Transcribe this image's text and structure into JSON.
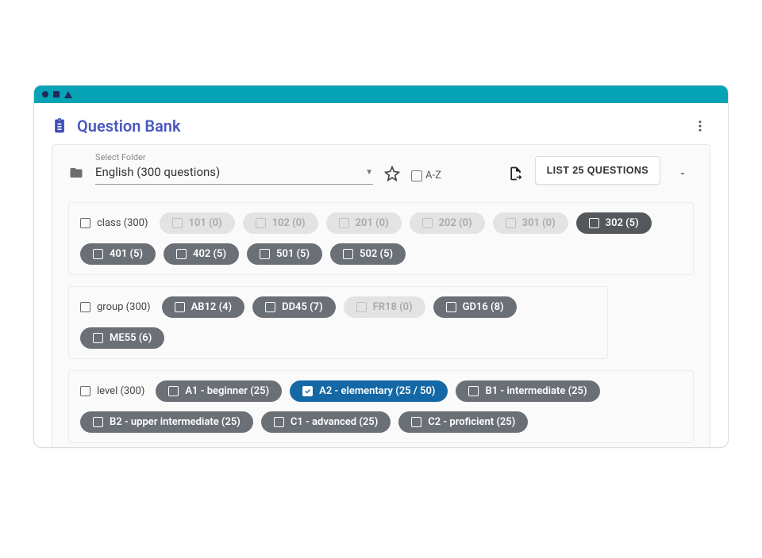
{
  "header": {
    "title": "Question Bank"
  },
  "toolbar": {
    "select_label": "Select Folder",
    "select_value": "English (300 questions)",
    "az_label": "A-Z",
    "list_button": "LIST 25 QUESTIONS"
  },
  "sections": {
    "class": {
      "label": "class (300)",
      "chips": [
        {
          "label": "101 (0)",
          "state": "light"
        },
        {
          "label": "102 (0)",
          "state": "light"
        },
        {
          "label": "201 (0)",
          "state": "light"
        },
        {
          "label": "202 (0)",
          "state": "light"
        },
        {
          "label": "301 (0)",
          "state": "light"
        },
        {
          "label": "302 (5)",
          "state": "darker"
        },
        {
          "label": "401 (5)",
          "state": "dark"
        },
        {
          "label": "402 (5)",
          "state": "dark"
        },
        {
          "label": "501 (5)",
          "state": "dark"
        },
        {
          "label": "502 (5)",
          "state": "dark"
        }
      ]
    },
    "group": {
      "label": "group (300)",
      "chips": [
        {
          "label": "AB12 (4)",
          "state": "dark"
        },
        {
          "label": "DD45 (7)",
          "state": "dark"
        },
        {
          "label": "FR18 (0)",
          "state": "light"
        },
        {
          "label": "GD16 (8)",
          "state": "dark"
        },
        {
          "label": "ME55 (6)",
          "state": "dark"
        }
      ]
    },
    "level": {
      "label": "level (300)",
      "chips": [
        {
          "label": "A1 - beginner (25)",
          "state": "dark"
        },
        {
          "label": "A2 - elementary (25 / 50)",
          "state": "selected"
        },
        {
          "label": "B1 - intermediate (25)",
          "state": "dark"
        },
        {
          "label": "B2 - upper intermediate (25)",
          "state": "dark"
        },
        {
          "label": "C1 - advanced (25)",
          "state": "dark"
        },
        {
          "label": "C2 - proficient (25)",
          "state": "dark"
        }
      ]
    }
  }
}
